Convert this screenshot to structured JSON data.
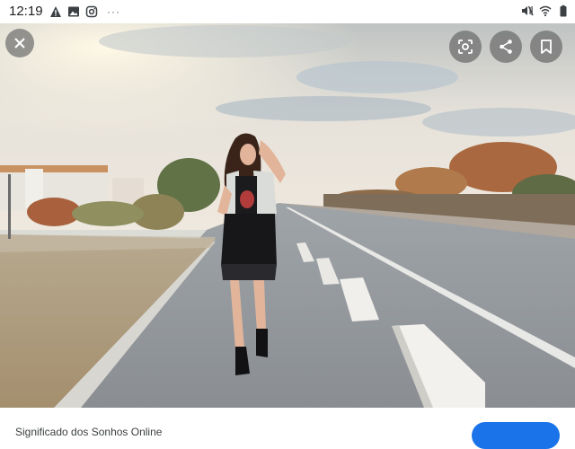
{
  "status_bar": {
    "time": "12:19",
    "left_icons": [
      "warning-icon",
      "image-icon",
      "instagram-icon"
    ],
    "overflow": "···",
    "right_icons": [
      "mute-icon",
      "wifi-icon",
      "battery-icon"
    ]
  },
  "viewer": {
    "actions": [
      "close-icon",
      "lens-icon",
      "share-icon",
      "bookmark-icon"
    ]
  },
  "footer": {
    "source_title": "Significado dos Sonhos Online"
  },
  "colors": {
    "accent": "#1a73e8",
    "overlay_button": "#6e6e6e"
  }
}
